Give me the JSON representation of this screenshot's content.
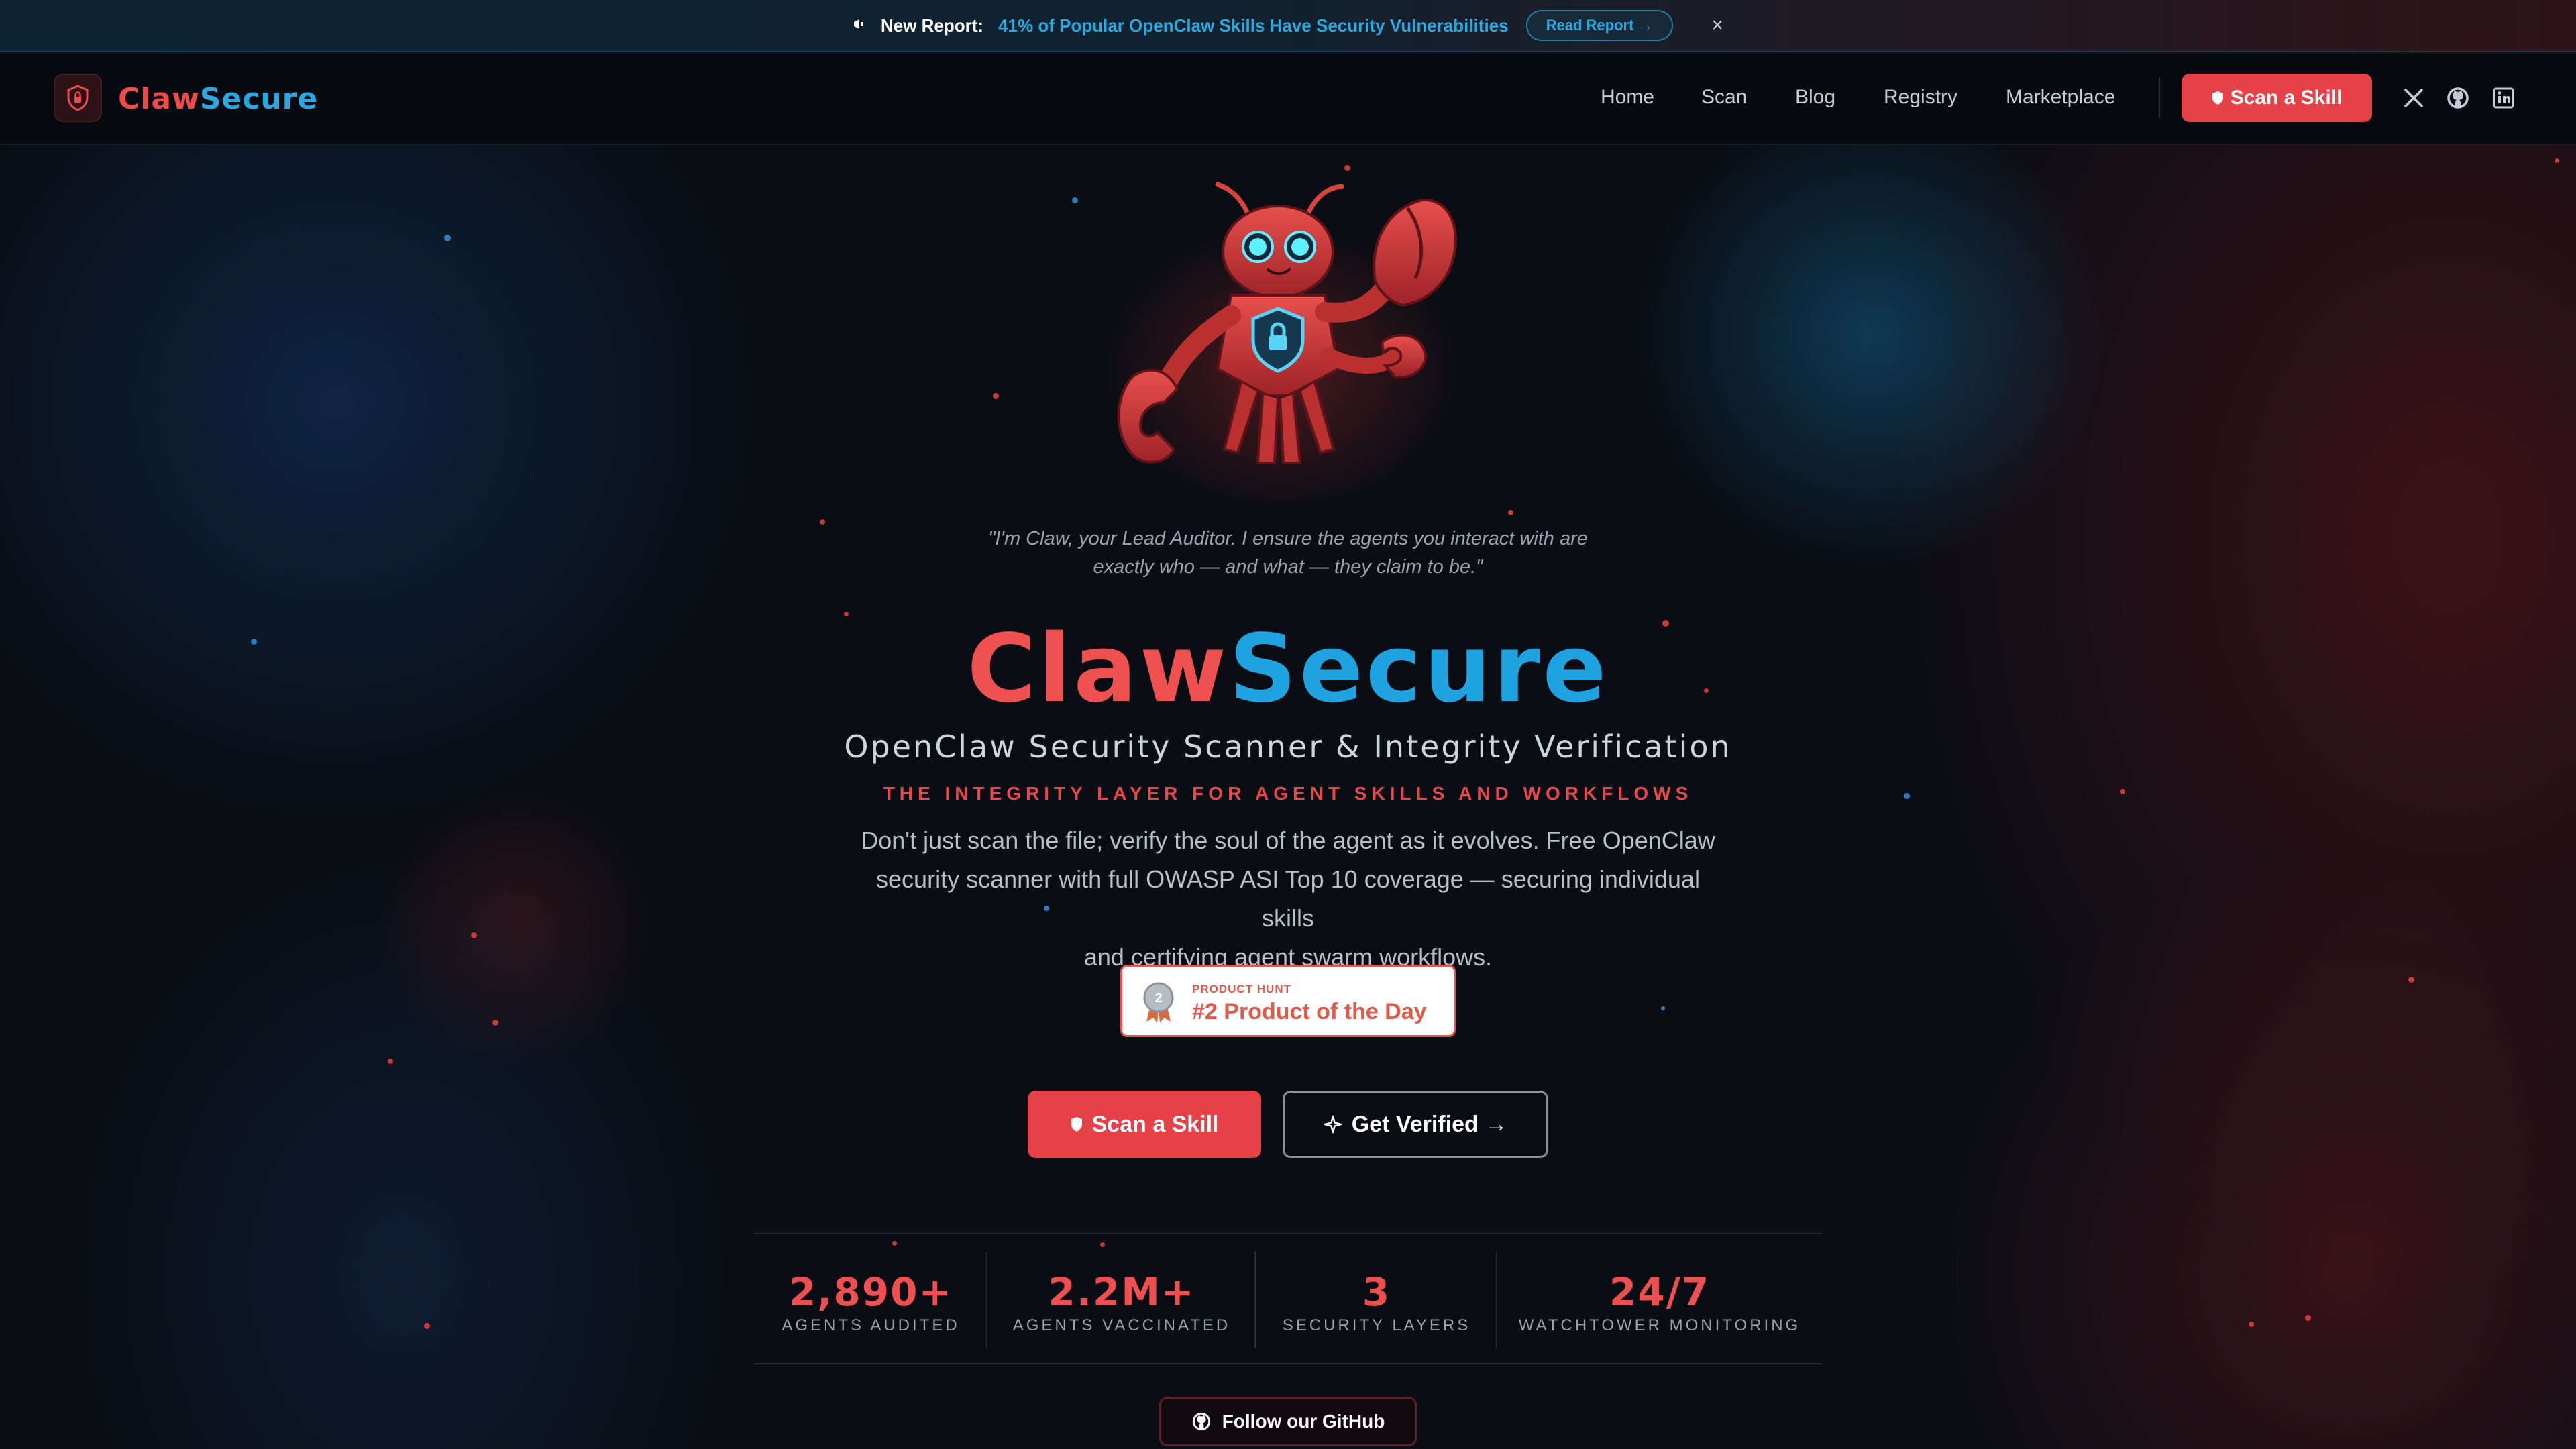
{
  "announcement": {
    "prefix_icon": "megaphone-icon",
    "lead": "New Report:",
    "link_text": "41% of Popular OpenClaw Skills Have Security Vulnerabilities",
    "button": "Read Report →",
    "close": "×"
  },
  "nav": {
    "logo_icon": "shield-icon",
    "logo_part1": "Claw",
    "logo_part2": "Secure",
    "links": [
      "Home",
      "Scan",
      "Blog",
      "Registry",
      "Marketplace"
    ],
    "cta": "Scan a Skill",
    "cta_icon": "shield-icon",
    "social": [
      "x-icon",
      "github-icon",
      "linkedin-icon"
    ]
  },
  "hero": {
    "quote_line1": "\"I'm Claw, your Lead Auditor. I ensure the agents you interact with are",
    "quote_line2": "exactly who — and what — they claim to be.\"",
    "brand_part1": "Claw",
    "brand_part2": "Secure",
    "subtitle": "OpenClaw Security Scanner & Integrity Verification",
    "tagline": "THE INTEGRITY LAYER FOR AGENT SKILLS AND WORKFLOWS",
    "desc_line1": "Don't just scan the file; verify the soul of the agent as it evolves. Free OpenClaw",
    "desc_line2": "security scanner with full OWASP ASI Top 10 coverage — securing individual skills",
    "desc_line3": "and certifying agent swarm workflows.",
    "badge_small": "PRODUCT HUNT",
    "badge_big": "#2 Product of the Day",
    "badge_medal_number": "2",
    "cta_primary": "Scan a Skill",
    "cta_secondary": "Get Verified →"
  },
  "stats": [
    {
      "value": "2,890+",
      "label": "AGENTS AUDITED"
    },
    {
      "value": "2.2M+",
      "label": "AGENTS VACCINATED"
    },
    {
      "value": "3",
      "label": "SECURITY LAYERS"
    },
    {
      "value": "24/7",
      "label": "WATCHTOWER MONITORING"
    }
  ],
  "github_button": "Follow our GitHub",
  "colors": {
    "accent_red": "#e64147",
    "accent_blue": "#1fa3e0",
    "background": "#0a0d14"
  }
}
